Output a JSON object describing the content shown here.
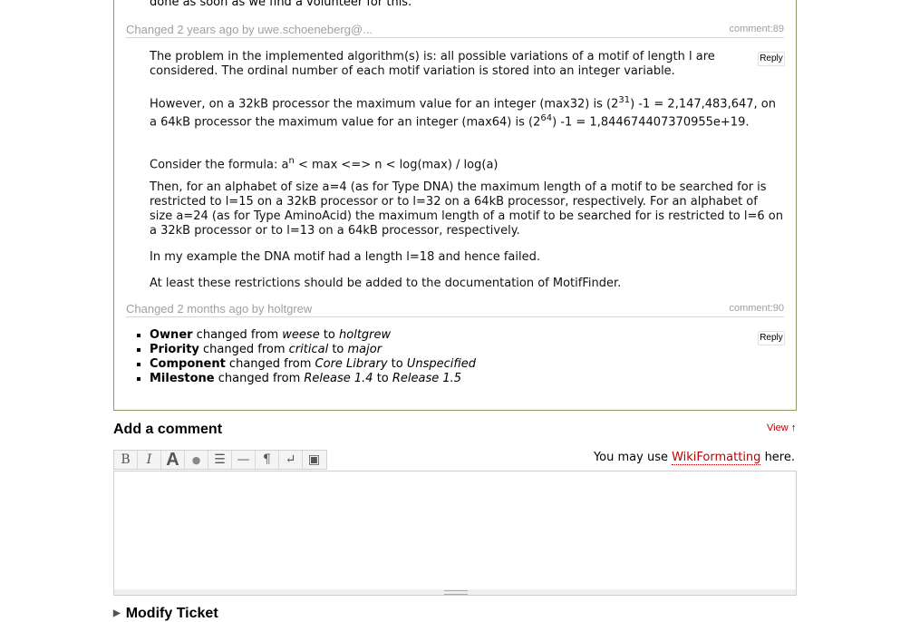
{
  "top_clipped_text": "done as soon as we find a volunteer for this.",
  "changes": [
    {
      "header_prefix": "Changed ",
      "age": "2 years",
      "header_mid": " ago by ",
      "author": "uwe.schoeneberg@...",
      "comment_id": "comment:89",
      "reply_label": "Reply"
    },
    {
      "header_prefix": "Changed ",
      "age": "2 months",
      "header_mid": " ago by ",
      "author": "holtgrew",
      "comment_id": "comment:90",
      "reply_label": "Reply"
    }
  ],
  "comment89": {
    "p1": "The problem in the implemented algorithm(s) is: all possible variations of a motif of length l are considered. The ordinal number of each motif variation is stored into an integer variable.",
    "p2a": "However, on a 32kB processor the maximum value for an integer (max32) is (2",
    "p2_exp1": "31",
    "p2b": ") -1 = 2,147,483,647, on a 64kB processor the maximum value for an integer (max64) is (2",
    "p2_exp2": "64",
    "p2c": ") -1 = 1,844674407370955e+19.",
    "p3a": "Consider the formula: a",
    "p3_exp": "n",
    "p3b": " < max <=> n < log(max) / log(a)",
    "p4": "Then, for an alphabet of size a=4 (as for Type DNA) the maximum length of a motif to be searched for is restricted to l=15 on a 32kB processor or to l=32 on a 64kB processor, respectively. For an alphabet of size a=24 (as for Type AminoAcid) the maximum length of a motif to be searched for is restricted to l=6 on a 32kB processor or to l=13 on a 64kB processor, respectively.",
    "p5": "In my example the DNA motif had a length l=18 and hence failed.",
    "p6": "At least these restrictions should be added to the documentation of MotifFinder."
  },
  "field_changes": [
    {
      "field": "Owner",
      "mid": " changed from ",
      "from": "weese",
      "to_word": " to ",
      "to": "holtgrew"
    },
    {
      "field": "Priority",
      "mid": " changed from ",
      "from": "critical",
      "to_word": " to ",
      "to": "major"
    },
    {
      "field": "Component",
      "mid": " changed from ",
      "from": "Core Library",
      "to_word": " to ",
      "to": "Unspecified"
    },
    {
      "field": "Milestone",
      "mid": " changed from ",
      "from": "Release 1.4",
      "to_word": " to ",
      "to": "Release 1.5"
    }
  ],
  "add_comment": {
    "title": "Add a comment",
    "view_label": "View",
    "view_arrow": "↑",
    "hint_prefix": "You may use ",
    "hint_link": "WikiFormatting",
    "hint_suffix": " here.",
    "textarea_value": ""
  },
  "toolbar": {
    "buttons": [
      {
        "icon": "bold-icon",
        "glyph": "B"
      },
      {
        "icon": "italic-icon",
        "glyph": "I"
      },
      {
        "icon": "heading-icon",
        "glyph": "A"
      },
      {
        "icon": "link-icon",
        "glyph": "●"
      },
      {
        "icon": "code-block-icon",
        "glyph": "☰"
      },
      {
        "icon": "horizontal-rule-icon",
        "glyph": "—"
      },
      {
        "icon": "paragraph-icon",
        "glyph": "¶"
      },
      {
        "icon": "line-break-icon",
        "glyph": "↵"
      },
      {
        "icon": "image-icon",
        "glyph": "▣"
      }
    ]
  },
  "modify_ticket": {
    "arrow": "▶",
    "label": "Modify Ticket"
  }
}
